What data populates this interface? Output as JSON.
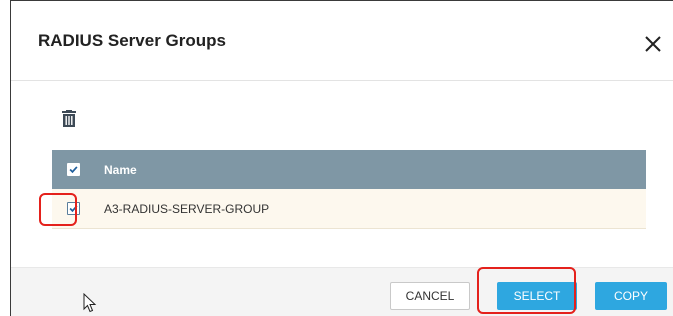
{
  "dialog": {
    "title": "RADIUS Server Groups",
    "close_icon": "close-icon"
  },
  "toolbar": {
    "delete_icon": "trash-icon"
  },
  "table": {
    "header": {
      "select_all_checked": true,
      "name_label": "Name"
    },
    "rows": [
      {
        "name": "A3-RADIUS-SERVER-GROUP",
        "checked": true
      }
    ]
  },
  "footer": {
    "cancel_label": "CANCEL",
    "select_label": "SELECT",
    "copy_label": "COPY"
  },
  "colors": {
    "header_bg": "#7f97a5",
    "row_bg": "#fdf8ee",
    "primary_button": "#2ea7e0",
    "highlight": "#e4211c",
    "checkbox_check": "#1f5f9c"
  }
}
